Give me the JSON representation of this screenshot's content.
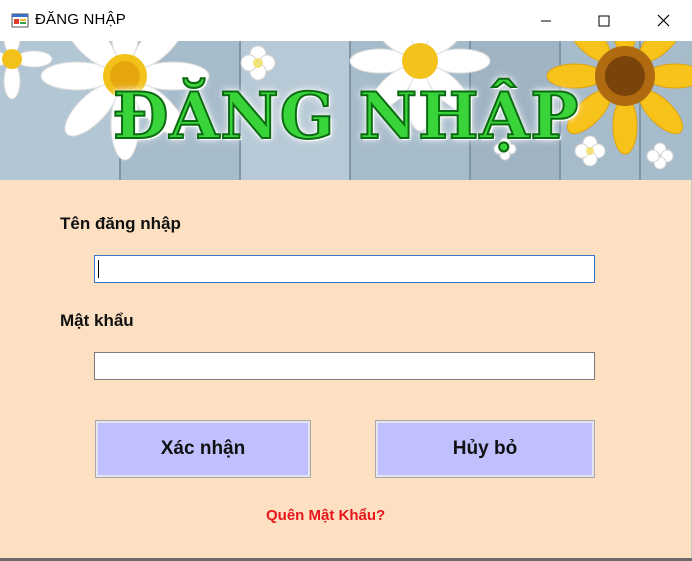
{
  "window": {
    "title": "ĐĂNG NHẬP",
    "controls": {
      "minimize_icon": "minimize-icon",
      "maximize_icon": "maximize-icon",
      "close_icon": "close-icon"
    }
  },
  "banner": {
    "title": "ĐĂNG NHẬP",
    "title_color": "#39d43a",
    "title_outline_color": "#0c6b12"
  },
  "form": {
    "username_label": "Tên đăng nhập",
    "username_value": "",
    "password_label": "Mật khẩu",
    "password_value": ""
  },
  "buttons": {
    "confirm_label": "Xác nhận",
    "cancel_label": "Hủy bỏ",
    "button_color": "#c0c0ff"
  },
  "links": {
    "forgot_password": "Quên Mật Khẩu?",
    "forgot_color": "#e8151b"
  },
  "colors": {
    "form_background": "#fde0c2"
  }
}
